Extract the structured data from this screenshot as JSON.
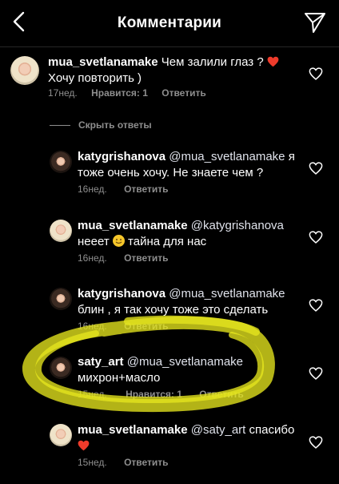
{
  "header": {
    "title": "Комментарии",
    "back_icon": "chevron-left-icon",
    "send_icon": "paper-plane-icon"
  },
  "comments": [
    {
      "username": "mua_svetlanamake",
      "body": " Чем залили глаз ? ",
      "body_line2": "Хочу повторить )",
      "time": "17нед.",
      "likes": "Нравится: 1",
      "reply": "Ответить"
    },
    {
      "username": "katygrishanova",
      "mention": "@mua_svetlanamake",
      "body": " я тоже очень хочу. Не знаете чем ?",
      "time": "16нед.",
      "reply": "Ответить"
    },
    {
      "username": "mua_svetlanamake",
      "mention": "@katygrishanova",
      "body_pre": "нееет ",
      "body_post": " тайна для нас",
      "time": "16нед.",
      "reply": "Ответить"
    },
    {
      "username": "katygrishanova",
      "mention": "@mua_svetlanamake",
      "body": "блин , я так хочу тоже это сделать",
      "time": "16нед.",
      "reply": "Ответить"
    },
    {
      "username": "saty_art",
      "mention": "@mua_svetlanamake",
      "body": "михрон+масло",
      "time": "15нед.",
      "likes": "Нравится: 1",
      "reply": "Ответить"
    },
    {
      "username": "mua_svetlanamake",
      "mention": "@saty_art",
      "body": " спасибо",
      "time": "15нед.",
      "reply": "Ответить"
    }
  ],
  "hide_replies": "Скрыть ответы",
  "colors": {
    "background": "#000000",
    "meta": "#8e8e8e",
    "heart": "#ee3b2b",
    "highlight": "#e6e61e"
  }
}
